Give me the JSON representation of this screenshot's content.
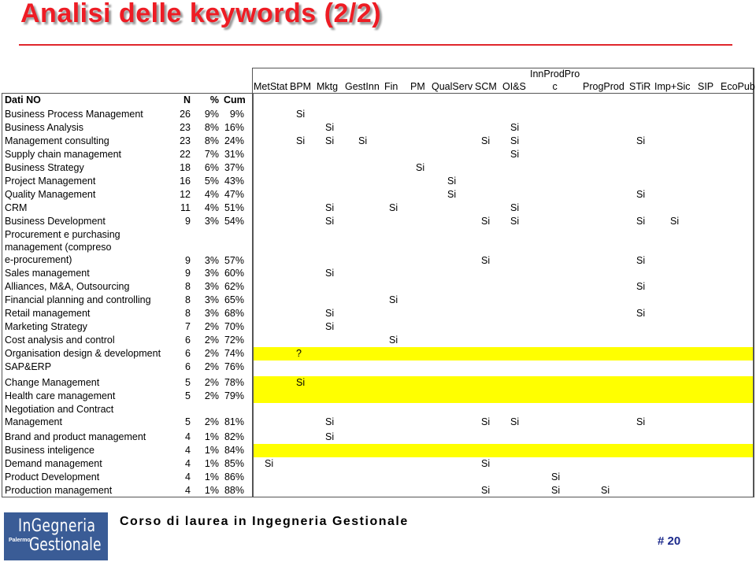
{
  "slide": {
    "title": "Analisi delle keywords (2/2)",
    "footer_course": "Corso di laurea in Ingegneria Gestionale",
    "page_number": "# 20",
    "logo": {
      "line1": "InGegneria",
      "line2_small": "Palermo",
      "line2": "Gestionale"
    },
    "colors": {
      "title": "#ee1c24",
      "highlight": "#ffff00",
      "logo_bg": "#3a5c96",
      "page_number": "#1c2a8c"
    }
  },
  "table": {
    "header": {
      "name": "Dati NO",
      "n": "N",
      "pct": "%",
      "cum": "Cum"
    },
    "columns": [
      "MetStat",
      "BPM",
      "Mktg",
      "GestInn",
      "Fin",
      "PM",
      "QualServ",
      "SCM",
      "OI&S",
      "InnProdProc",
      "ProgProd",
      "STiR",
      "Imp+Sic",
      "SIP",
      "EcoPub"
    ],
    "column_labels": [
      "MetStat",
      "BPM",
      "Mktg",
      "GestInn",
      "Fin",
      "PM",
      "QualServ",
      "SCM",
      "OI&S",
      "InnProdPro\nc",
      "ProgProd",
      "STiR",
      "Imp+Sic",
      "SIP",
      "EcoPub"
    ],
    "rows": [
      {
        "name": "Business Process Management",
        "n": "26",
        "pct": "9%",
        "cum": "9%",
        "marks": {
          "BPM": "Si"
        }
      },
      {
        "name": "Business Analysis",
        "n": "23",
        "pct": "8%",
        "cum": "16%",
        "marks": {
          "Mktg": "Si",
          "OI&S": "Si"
        }
      },
      {
        "name": "Management consulting",
        "n": "23",
        "pct": "8%",
        "cum": "24%",
        "marks": {
          "BPM": "Si",
          "Mktg": "Si",
          "GestInn": "Si",
          "SCM": "Si",
          "OI&S": "Si",
          "STiR": "Si"
        }
      },
      {
        "name": "Supply chain management",
        "n": "22",
        "pct": "7%",
        "cum": "31%",
        "marks": {
          "OI&S": "Si"
        }
      },
      {
        "name": "Business Strategy",
        "n": "18",
        "pct": "6%",
        "cum": "37%",
        "marks": {
          "PM": "Si"
        }
      },
      {
        "name": "Project Management",
        "n": "16",
        "pct": "5%",
        "cum": "43%",
        "marks": {
          "QualServ": "Si"
        }
      },
      {
        "name": "Quality Management",
        "n": "12",
        "pct": "4%",
        "cum": "47%",
        "marks": {
          "QualServ": "Si",
          "STiR": "Si"
        }
      },
      {
        "name": "CRM",
        "n": "11",
        "pct": "4%",
        "cum": "51%",
        "marks": {
          "Mktg": "Si",
          "Fin": "Si",
          "OI&S": "Si"
        }
      },
      {
        "name": "Business Development",
        "n": "9",
        "pct": "3%",
        "cum": "54%",
        "marks": {
          "Mktg": "Si",
          "SCM": "Si",
          "OI&S": "Si",
          "STiR": "Si",
          "Imp+Sic": "Si"
        }
      },
      {
        "name": "Procurement e purchasing management (compreso e-procurement)",
        "n": "9",
        "pct": "3%",
        "cum": "57%",
        "marks": {
          "SCM": "Si",
          "STiR": "Si"
        }
      },
      {
        "name": "Sales management",
        "n": "9",
        "pct": "3%",
        "cum": "60%",
        "marks": {
          "Mktg": "Si"
        }
      },
      {
        "name": "Alliances, M&A, Outsourcing",
        "n": "8",
        "pct": "3%",
        "cum": "62%",
        "marks": {
          "STiR": "Si"
        }
      },
      {
        "name": "Financial planning and controlling",
        "n": "8",
        "pct": "3%",
        "cum": "65%",
        "marks": {
          "Fin": "Si"
        }
      },
      {
        "name": "Retail management",
        "n": "8",
        "pct": "3%",
        "cum": "68%",
        "marks": {
          "Mktg": "Si",
          "STiR": "Si"
        }
      },
      {
        "name": "Marketing Strategy",
        "n": "7",
        "pct": "2%",
        "cum": "70%",
        "marks": {
          "Mktg": "Si"
        }
      },
      {
        "name": "Cost analysis and control",
        "n": "6",
        "pct": "2%",
        "cum": "72%",
        "marks": {
          "Fin": "Si"
        }
      },
      {
        "name": "Organisation design & development",
        "n": "6",
        "pct": "2%",
        "cum": "74%",
        "highlight": true,
        "marks": {
          "BPM": "?"
        }
      },
      {
        "name": "SAP&ERP",
        "n": "6",
        "pct": "2%",
        "cum": "76%",
        "marks": {}
      },
      {
        "name": "Change Management",
        "n": "5",
        "pct": "2%",
        "cum": "78%",
        "highlight": true,
        "marks": {
          "BPM": "Si"
        }
      },
      {
        "name": "Health care management",
        "n": "5",
        "pct": "2%",
        "cum": "79%",
        "highlight": true,
        "marks": {}
      },
      {
        "name": "Negotiation and Contract Management",
        "n": "5",
        "pct": "2%",
        "cum": "81%",
        "marks": {
          "Mktg": "Si",
          "SCM": "Si",
          "OI&S": "Si",
          "STiR": "Si"
        }
      },
      {
        "name": "Brand and product management",
        "n": "4",
        "pct": "1%",
        "cum": "82%",
        "marks": {
          "Mktg": "Si"
        }
      },
      {
        "name": "Business inteligence",
        "n": "4",
        "pct": "1%",
        "cum": "84%",
        "highlight": true,
        "marks": {}
      },
      {
        "name": "Demand management",
        "n": "4",
        "pct": "1%",
        "cum": "85%",
        "marks": {
          "MetStat": "Si",
          "SCM": "Si"
        }
      },
      {
        "name": "Product Development",
        "n": "4",
        "pct": "1%",
        "cum": "86%",
        "marks": {
          "InnProdProc": "Si"
        }
      },
      {
        "name": "Production management",
        "n": "4",
        "pct": "1%",
        "cum": "88%",
        "marks": {
          "SCM": "Si",
          "InnProdProc": "Si",
          "ProgProd": "Si"
        }
      }
    ]
  }
}
